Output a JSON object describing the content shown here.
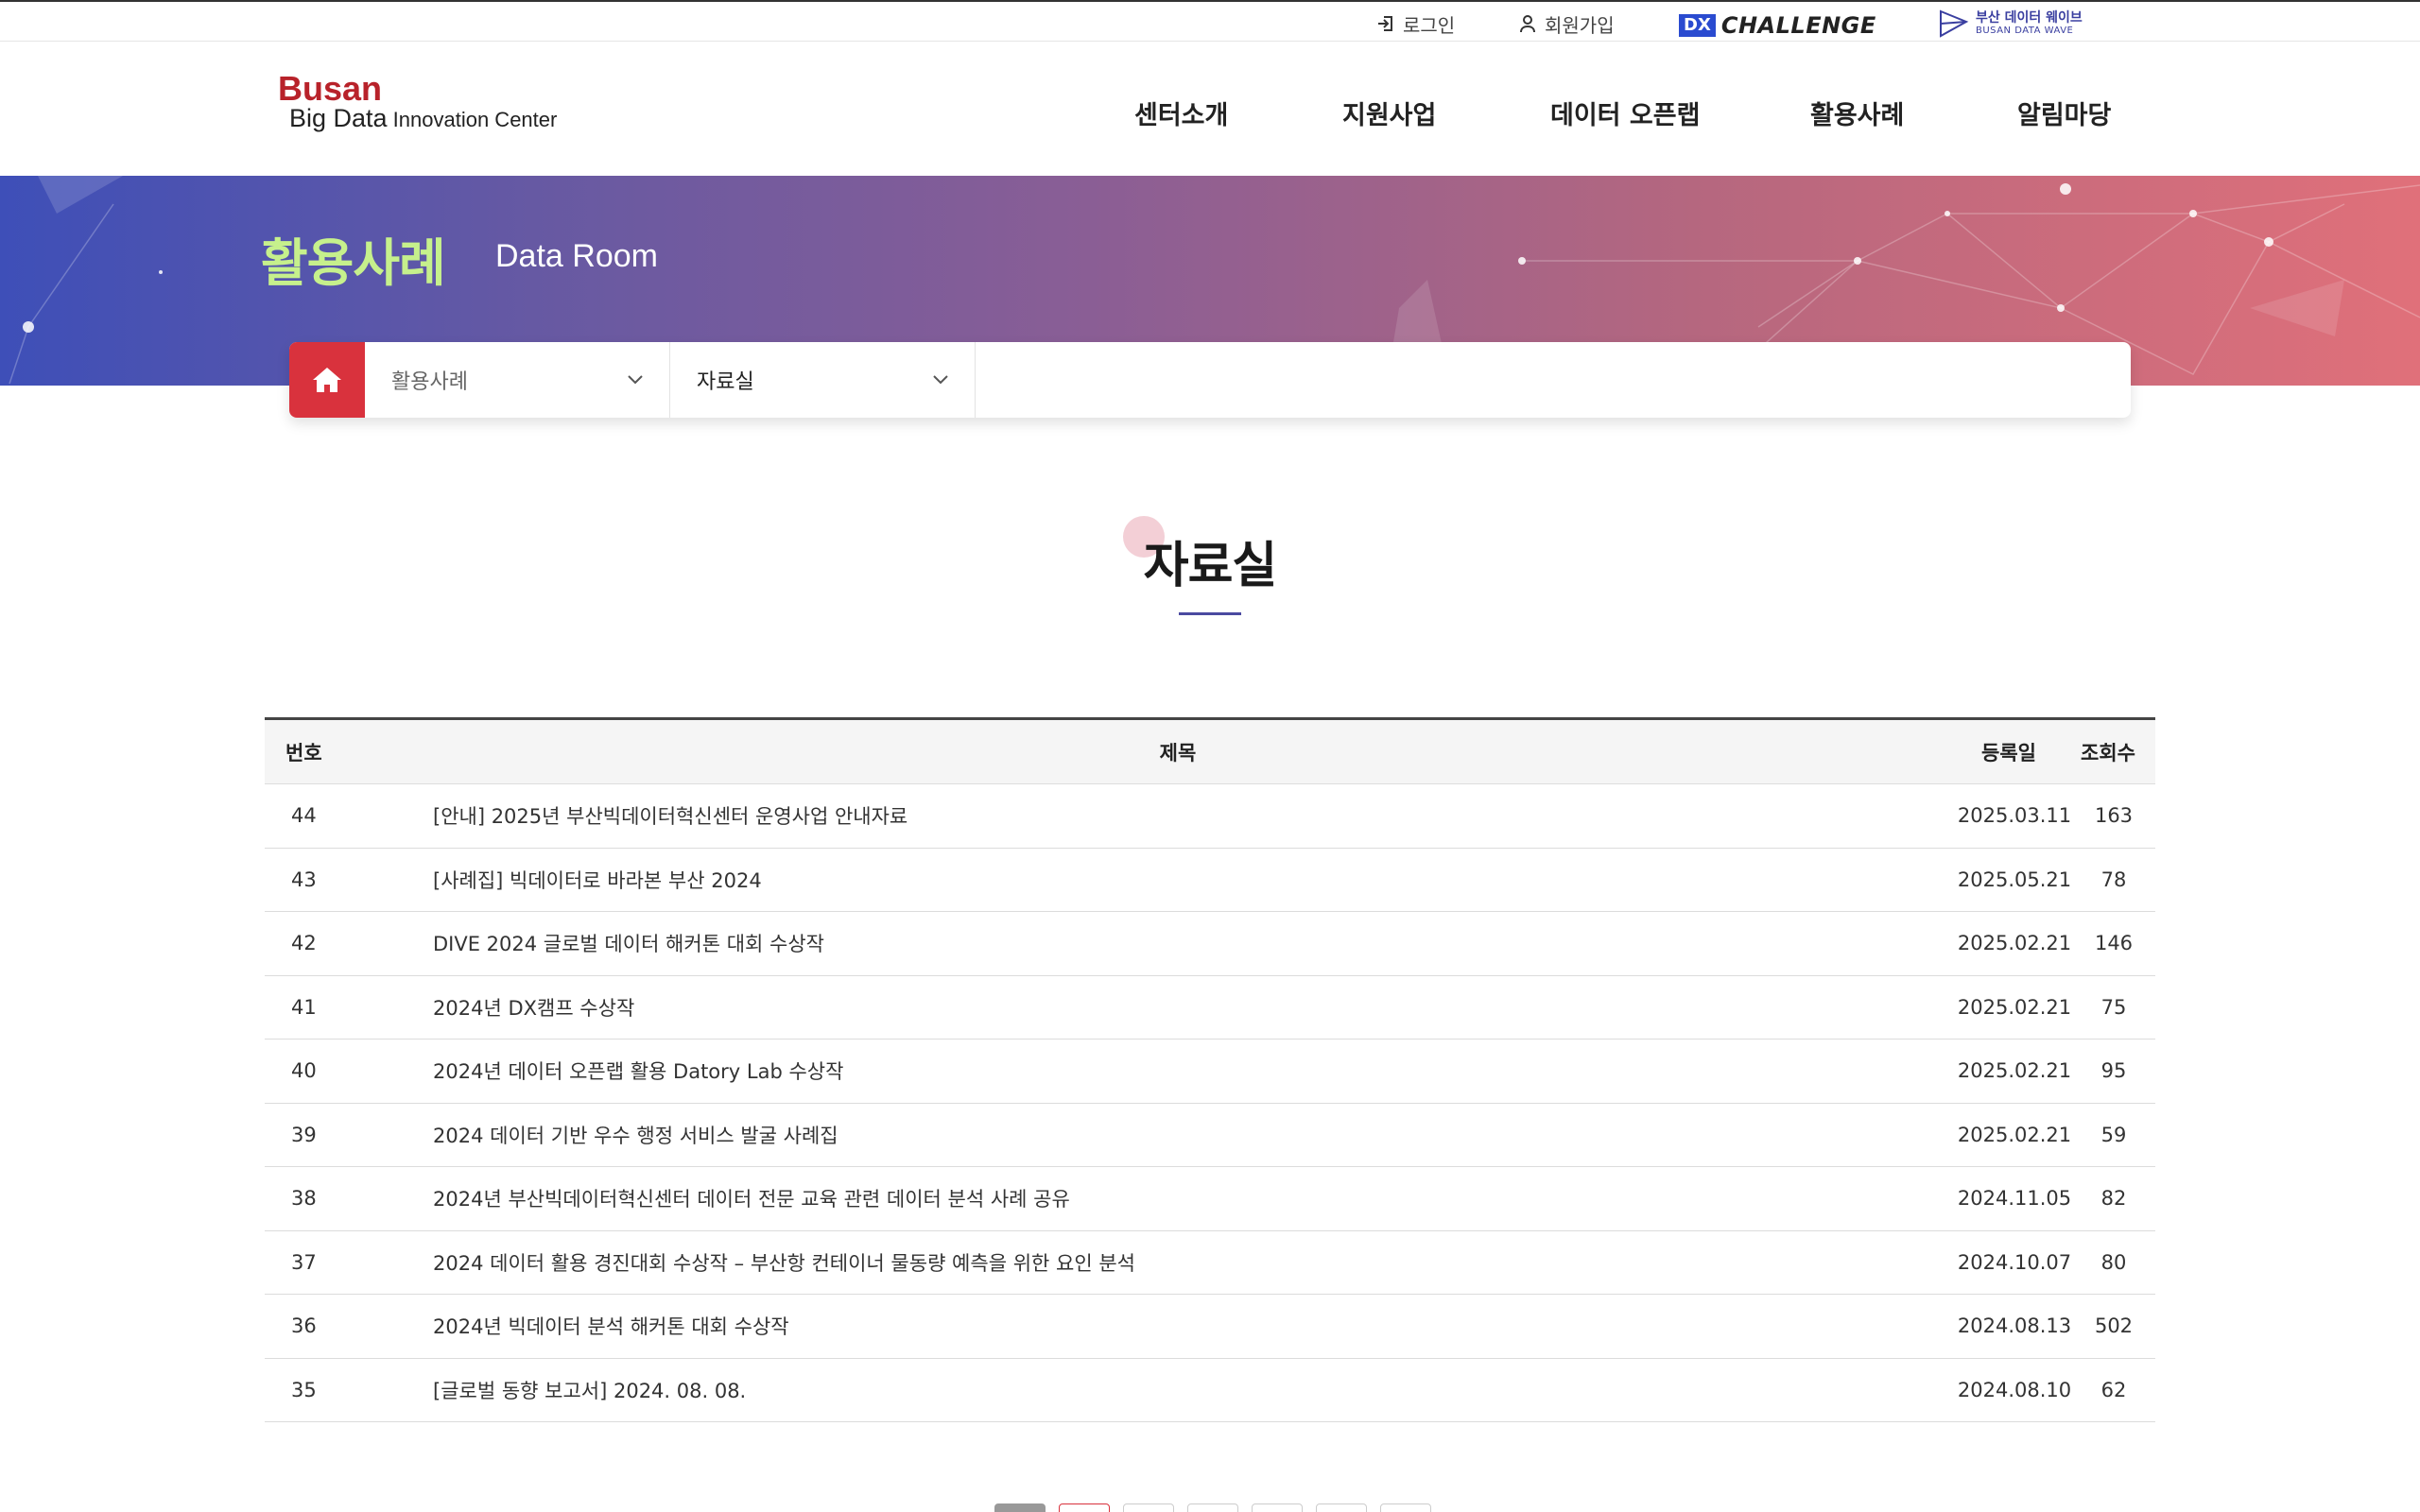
{
  "util": {
    "login": "로그인",
    "join": "회원가입"
  },
  "dx": {
    "badge": "DX",
    "text": "CHALLENGE"
  },
  "wave": {
    "line1": "부산 데이터 웨이브",
    "line2": "BUSAN DATA WAVE"
  },
  "logo": {
    "line1": "Busan",
    "line2_big": "Big Data",
    "line2_rest": " Innovation Center"
  },
  "gnb": [
    "센터소개",
    "지원사업",
    "데이터 오픈랩",
    "활용사례",
    "알림마당"
  ],
  "banner": {
    "title": "활용사례",
    "subtitle": "Data Room"
  },
  "crumb": {
    "depth1": "활용사례",
    "depth2": "자료실"
  },
  "page_title": "자료실",
  "table": {
    "headers": {
      "num": "번호",
      "title": "제목",
      "date": "등록일",
      "views": "조회수"
    },
    "rows": [
      {
        "num": "44",
        "title": "[안내] 2025년 부산빅데이터혁신센터 운영사업 안내자료",
        "date": "2025.03.11",
        "views": "163"
      },
      {
        "num": "43",
        "title": "[사례집] 빅데이터로 바라본 부산 2024",
        "date": "2025.05.21",
        "views": "78"
      },
      {
        "num": "42",
        "title": "DIVE 2024 글로벌 데이터 해커톤 대회 수상작",
        "date": "2025.02.21",
        "views": "146"
      },
      {
        "num": "41",
        "title": "2024년 DX캠프 수상작",
        "date": "2025.02.21",
        "views": "75"
      },
      {
        "num": "40",
        "title": "2024년 데이터 오픈랩 활용 Datory Lab 수상작",
        "date": "2025.02.21",
        "views": "95"
      },
      {
        "num": "39",
        "title": "2024 데이터 기반 우수 행정 서비스 발굴 사례집",
        "date": "2025.02.21",
        "views": "59"
      },
      {
        "num": "38",
        "title": "2024년 부산빅데이터혁신센터 데이터 전문 교육 관련 데이터 분석 사례 공유",
        "date": "2024.11.05",
        "views": "82"
      },
      {
        "num": "37",
        "title": "2024 데이터 활용 경진대회 수상작 – 부산항 컨테이너 물동량 예측을 위한 요인 분석",
        "date": "2024.10.07",
        "views": "80"
      },
      {
        "num": "36",
        "title": "2024년 빅데이터 분석 해커톤 대회 수상작",
        "date": "2024.08.13",
        "views": "502"
      },
      {
        "num": "35",
        "title": "[글로벌 동향 보고서] 2024. 08. 08.",
        "date": "2024.08.10",
        "views": "62"
      }
    ]
  },
  "colors": {
    "accent": "#d9323d",
    "banner_title": "#c6f08c",
    "title_line": "#4b4aa0"
  }
}
